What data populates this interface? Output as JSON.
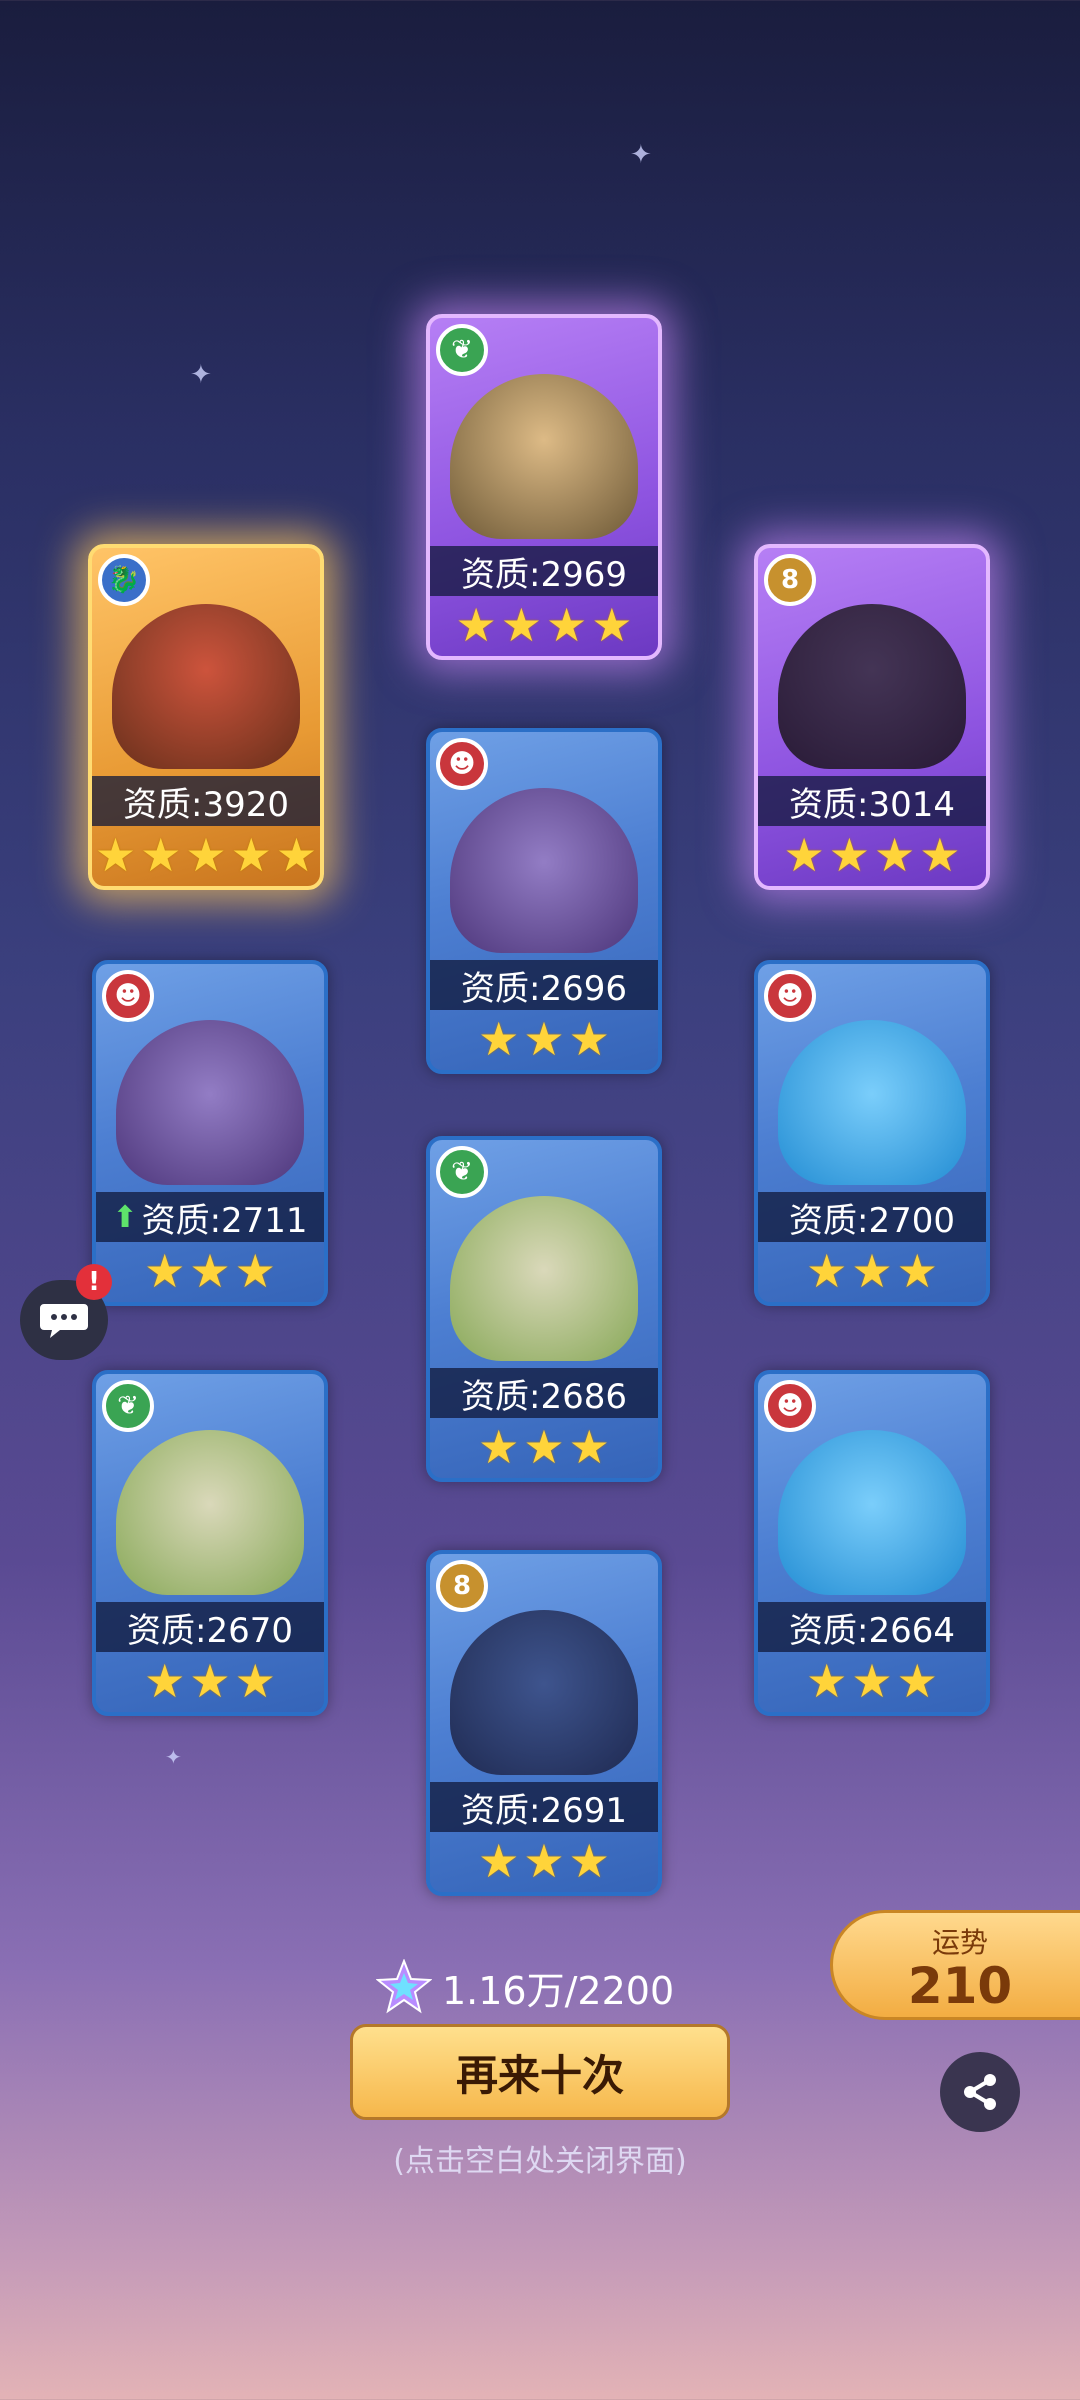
{
  "cards": [
    {
      "stat_label": "资质:3920",
      "rarity": "legendary",
      "element": "ice-dragon",
      "stars": 5,
      "boosted": false
    },
    {
      "stat_label": "资质:2969",
      "rarity": "epic",
      "element": "nature",
      "stars": 4,
      "boosted": false
    },
    {
      "stat_label": "资质:3014",
      "rarity": "epic",
      "element": "earth",
      "stars": 4,
      "boosted": false
    },
    {
      "stat_label": "资质:2696",
      "rarity": "rare",
      "element": "fire",
      "stars": 3,
      "boosted": false
    },
    {
      "stat_label": "资质:2711",
      "rarity": "rare",
      "element": "fire",
      "stars": 3,
      "boosted": true
    },
    {
      "stat_label": "资质:2700",
      "rarity": "rare",
      "element": "fire",
      "stars": 3,
      "boosted": false
    },
    {
      "stat_label": "资质:2686",
      "rarity": "rare",
      "element": "nature",
      "stars": 3,
      "boosted": false
    },
    {
      "stat_label": "资质:2670",
      "rarity": "rare",
      "element": "nature",
      "stars": 3,
      "boosted": false
    },
    {
      "stat_label": "资质:2664",
      "rarity": "rare",
      "element": "fire",
      "stars": 3,
      "boosted": false
    },
    {
      "stat_label": "资质:2691",
      "rarity": "rare",
      "element": "earth",
      "stars": 3,
      "boosted": false
    }
  ],
  "fortune": {
    "label": "运势",
    "value": "210"
  },
  "resource": {
    "text": "1.16万/2200",
    "icon": "star-crystal-icon"
  },
  "buttons": {
    "draw_again": "再来十次"
  },
  "hint": "(点击空白处关闭界面)",
  "colors": {
    "legendary": "#ffc467",
    "epic": "#b67ff5",
    "rare": "#4d7fd2",
    "button": "#f6b74b"
  }
}
